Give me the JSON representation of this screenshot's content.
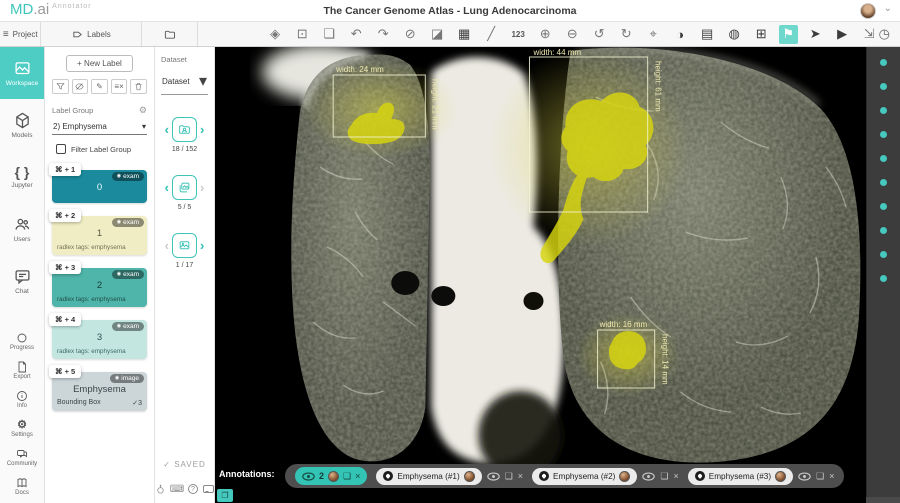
{
  "header": {
    "logo_md": "MD",
    "logo_ai": ".ai",
    "logo_sub": "Annotator",
    "title": "The Cancer Genome Atlas - Lung Adenocarcinoma"
  },
  "tabs": {
    "project": "Project",
    "labels": "Labels"
  },
  "sidebar": {
    "items": [
      {
        "label": "Workspace",
        "icon": "workspace-icon"
      },
      {
        "label": "Models",
        "icon": "models-icon"
      },
      {
        "label": "Jupyter",
        "icon": "jupyter-icon"
      },
      {
        "label": "Users",
        "icon": "users-icon"
      },
      {
        "label": "Chat",
        "icon": "chat-icon"
      }
    ],
    "bottom_items": [
      {
        "label": "Progress",
        "icon": "progress-icon"
      },
      {
        "label": "Export",
        "icon": "export-icon"
      },
      {
        "label": "Info",
        "icon": "info-icon"
      },
      {
        "label": "Settings",
        "icon": "settings-icon",
        "glyph": "⚙"
      },
      {
        "label": "Community",
        "icon": "community-icon"
      },
      {
        "label": "Docs",
        "icon": "docs-icon"
      }
    ]
  },
  "labels_panel": {
    "new_label_button": "+ New Label",
    "group_title": "Label Group",
    "group_value": "2) Emphysema",
    "filter_label": "Filter Label Group",
    "cards": [
      {
        "shortcut": "⌘ + 1",
        "title": "0",
        "scope": "exam",
        "tags": ""
      },
      {
        "shortcut": "⌘ + 2",
        "title": "1",
        "scope": "exam",
        "tags": "radlex tags: emphysema"
      },
      {
        "shortcut": "⌘ + 3",
        "title": "2",
        "scope": "exam",
        "tags": "radlex tags: emphysema"
      },
      {
        "shortcut": "⌘ + 4",
        "title": "3",
        "scope": "exam",
        "tags": "radlex tags: emphysema"
      },
      {
        "shortcut": "⌘ + 5",
        "title": "Emphysema",
        "scope": "image",
        "type": "Bounding Box",
        "count": "✓3"
      }
    ],
    "saved": "✓ SAVED"
  },
  "series_panel": {
    "dataset_label": "Dataset",
    "dataset_value": "Dataset",
    "dropdown_caret": "▾",
    "navs": [
      {
        "name": "exam",
        "count": "18 / 152"
      },
      {
        "name": "series",
        "count": "5 / 5"
      },
      {
        "name": "image",
        "count": "1 / 17"
      }
    ]
  },
  "toolbar": {
    "icons": [
      {
        "name": "3d-mpr-icon",
        "glyph": "◈"
      },
      {
        "name": "screenshot-icon",
        "glyph": "⊡"
      },
      {
        "name": "copy-image-icon",
        "glyph": "❏"
      },
      {
        "name": "undo-icon",
        "glyph": "↶"
      },
      {
        "name": "redo-icon",
        "glyph": "↷"
      },
      {
        "name": "hide-drawings-icon",
        "glyph": "⊘"
      },
      {
        "name": "eraser-icon",
        "glyph": "◪"
      },
      {
        "name": "grid-layout-icon",
        "glyph": "▦",
        "dark": true
      },
      {
        "name": "ruler-icon",
        "glyph": "╱"
      },
      {
        "name": "numbers-icon",
        "glyph": "123",
        "text": true
      },
      {
        "name": "zoom-in-icon",
        "glyph": "⊕"
      },
      {
        "name": "zoom-out-icon",
        "glyph": "⊖"
      },
      {
        "name": "rotate-icon",
        "glyph": "↺"
      },
      {
        "name": "reset-view-icon",
        "glyph": "↻"
      },
      {
        "name": "focus-icon",
        "glyph": "⌖"
      },
      {
        "name": "contrast-icon",
        "glyph": "◑",
        "dark": true
      },
      {
        "name": "window-level-icon",
        "glyph": "▤",
        "dark": true
      },
      {
        "name": "brightness-icon",
        "glyph": "◍",
        "dark": true
      },
      {
        "name": "stack-icon",
        "glyph": "⊞",
        "dark": true
      },
      {
        "name": "hide-annotations-icon",
        "glyph": "⚑",
        "active": true
      },
      {
        "name": "hide-cursor-icon",
        "glyph": "➤",
        "dark": true
      },
      {
        "name": "play-icon",
        "glyph": "▶",
        "dark": true
      },
      {
        "name": "fullscreen-icon",
        "glyph": "⇲"
      }
    ],
    "clock_glyph": "◷"
  },
  "viewer": {
    "boxes": [
      {
        "width_label": "width: 24 mm",
        "height_label": "height: 21 mm"
      },
      {
        "width_label": "width: 44 mm",
        "height_label": "height: 61 mm"
      },
      {
        "width_label": "width: 16 mm",
        "height_label": "height: 14 mm"
      }
    ],
    "indicator_dots": 10
  },
  "annotations_bar": {
    "label": "Annotations:",
    "visible_count": "2",
    "chips": [
      {
        "label": "Emphysema (#1)"
      },
      {
        "label": "Emphysema (#2)"
      },
      {
        "label": "Emphysema (#3)"
      }
    ]
  },
  "colors": {
    "accent": "#4ecdc4",
    "toolbar_active": "#6fd8cd",
    "card0": "#1a8a9c",
    "card1": "#f0edc4",
    "card2": "#4fb4a9",
    "card3": "#c3e6e1",
    "card4": "#ccd5d8",
    "annotation_yellow": "#d8d60e",
    "strip_bg": "#3c3c3c"
  }
}
